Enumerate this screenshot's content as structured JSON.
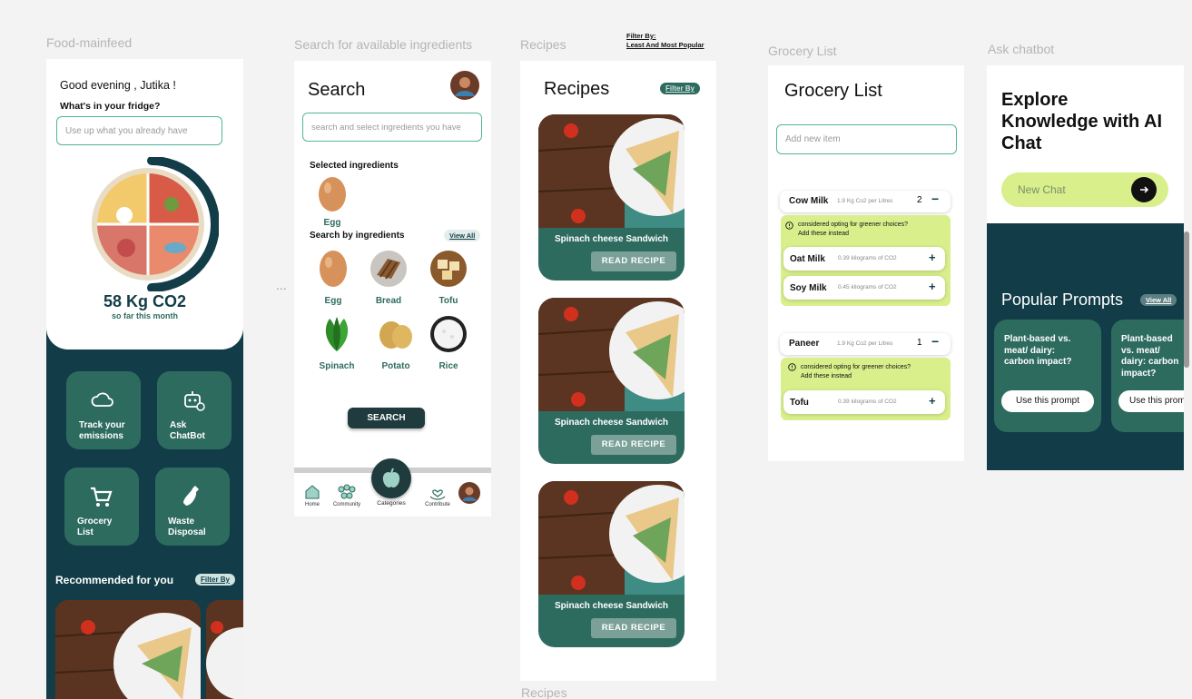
{
  "frame_labels": {
    "food": "Food-mainfeed",
    "search": "Search for available ingredients",
    "recipes": "Recipes",
    "grocery": "Grocery List",
    "chatbot": "Ask chatbot",
    "recipes_bottom": "Recipes",
    "filter_note_line1": "Filter By:",
    "filter_note_line2": "Least And Most Popular",
    "ellipsis": "..."
  },
  "mainfeed": {
    "greeting": "Good evening , Jutika !",
    "fridge_question": "What's in your fridge?",
    "fridge_placeholder": "Use up what you already have",
    "co2_value": "58 Kg CO2",
    "co2_caption": "so far this month",
    "co2_progress": 0.5,
    "tiles": [
      {
        "label": "Track your emissions",
        "icon": "cloud-icon"
      },
      {
        "label": "Ask ChatBot",
        "icon": "robot-icon"
      },
      {
        "label": "Grocery List",
        "icon": "cart-icon"
      },
      {
        "label": "Waste Disposal",
        "icon": "bottle-icon"
      }
    ],
    "recommended_title": "Recommended for you",
    "filter_label": "Filter By"
  },
  "search": {
    "title": "Search",
    "placeholder": "search and select ingredients you have",
    "selected_title": "Selected ingredients",
    "selected": [
      {
        "label": "Egg",
        "icon": "egg-icon"
      }
    ],
    "by_ingredients_title": "Search by ingredients",
    "view_all": "View All",
    "ingredients": [
      {
        "label": "Egg",
        "icon": "egg-icon"
      },
      {
        "label": "Bread",
        "icon": "bread-icon"
      },
      {
        "label": "Tofu",
        "icon": "tofu-icon"
      },
      {
        "label": "Spinach",
        "icon": "spinach-icon"
      },
      {
        "label": "Potato",
        "icon": "potato-icon"
      },
      {
        "label": "Rice",
        "icon": "rice-icon"
      }
    ],
    "search_button": "SEARCH",
    "nav": [
      {
        "label": "Home",
        "icon": "home-icon"
      },
      {
        "label": "Community",
        "icon": "community-icon"
      },
      {
        "label": "Categories",
        "icon": "apple-icon"
      },
      {
        "label": "Contribute",
        "icon": "hand-heart-icon"
      }
    ]
  },
  "recipes": {
    "title": "Recipes",
    "filter_label": "Filter By",
    "cards": [
      {
        "caption": "Spinach cheese Sandwich",
        "button": "READ RECIPE"
      },
      {
        "caption": "Spinach cheese Sandwich",
        "button": "READ RECIPE"
      },
      {
        "caption": "Spinach cheese Sandwich",
        "button": "READ RECIPE"
      }
    ]
  },
  "grocery": {
    "title": "Grocery List",
    "placeholder": "Add new item",
    "items": [
      {
        "name": "Cow Milk",
        "co2": "1.9 Kg Co2 per Litres",
        "qty": "2",
        "note_line1": "considered opting for greener choices?",
        "note_line2": "Add these instead",
        "alternatives": [
          {
            "name": "Oat Milk",
            "co2": "0.39 kilograms of CO2"
          },
          {
            "name": "Soy Milk",
            "co2": "0.45 kilograms of CO2"
          }
        ]
      },
      {
        "name": "Paneer",
        "co2": "1.9 Kg Co2 per Litres",
        "qty": "1",
        "note_line1": "considered opting for greener choices?",
        "note_line2": "Add these instead",
        "alternatives": [
          {
            "name": "Tofu",
            "co2": "0.39 kilograms of CO2"
          }
        ]
      }
    ]
  },
  "chatbot": {
    "heading_line1": "Explore",
    "heading_line2": "Knowledge with AI",
    "heading_line3": "Chat",
    "new_chat": "New Chat",
    "popular_title": "Popular Prompts",
    "view_all": "View All",
    "prompts": [
      {
        "text": "Plant-based vs. meat/ dairy: carbon impact?",
        "button": "Use this prompt"
      },
      {
        "text": "Plant-based vs. meat/ dairy: carbon impact?",
        "button": "Use this prom"
      }
    ]
  },
  "colors": {
    "teal": "#2e6b5f",
    "dark": "#123d48",
    "lime": "#d8ef8c",
    "accent": "#4fb79a"
  }
}
